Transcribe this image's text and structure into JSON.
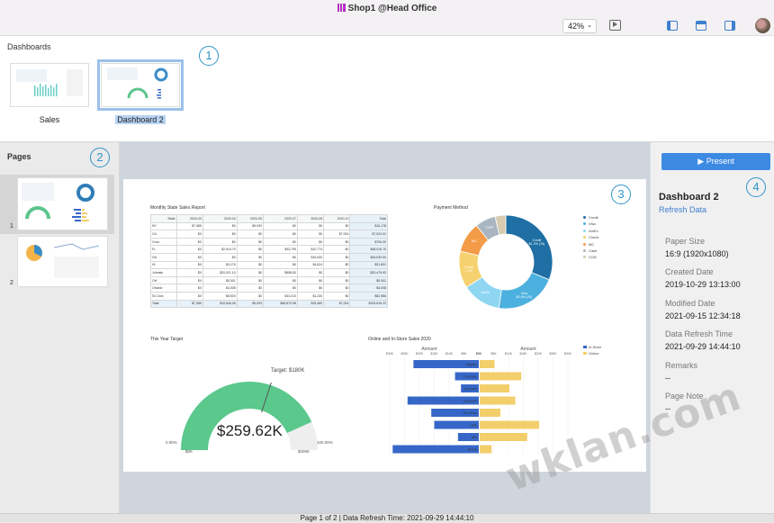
{
  "window": {
    "title": "Shop1 @Head Office",
    "zoom": "42%"
  },
  "toolbar": {
    "icons": [
      "presentation-icon",
      "layout-left-panel-icon",
      "layout-top-panel-icon",
      "layout-right-panel-icon"
    ]
  },
  "dashboards": {
    "label": "Dashboards",
    "items": [
      {
        "label": "Sales",
        "selected": false
      },
      {
        "label": "Dashboard 2",
        "selected": true
      }
    ]
  },
  "markers": [
    "1",
    "2",
    "3",
    "4"
  ],
  "pages": {
    "label": "Pages",
    "items": [
      {
        "number": "1",
        "selected": true
      },
      {
        "number": "2",
        "selected": false
      }
    ]
  },
  "report": {
    "table_title": "Monthly State Sales Report",
    "table_headers": [
      "State",
      "2020-03",
      "2020-04",
      "2020-05",
      "2020-07",
      "2020-08",
      "2020-10",
      "Total"
    ],
    "table_rows": [
      [
        "NY",
        "$7,085",
        "$0",
        "$9,093",
        "$0",
        "$0",
        "$0",
        "$16,178"
      ],
      [
        "CA",
        "$0",
        "$0",
        "$0",
        "$0",
        "$0",
        "$7,024",
        "$7,024.01"
      ],
      [
        "Conn",
        "$0",
        "$0",
        "$0",
        "$0",
        "$0",
        "$0",
        "$706.00"
      ],
      [
        "FL",
        "$0",
        "$2,914.70",
        "$0",
        "$33,795",
        "$10,774",
        "$0",
        "$48,016.70"
      ],
      [
        "GA",
        "$0",
        "$0",
        "$0",
        "$0",
        "$16,630",
        "$0",
        "$34,630.00"
      ],
      [
        "HI",
        "$0",
        "$3,176",
        "$0",
        "$0",
        "$4,624",
        "$0",
        "$31,801"
      ],
      [
        "Johnstn",
        "$0",
        "$20,021.10",
        "$0",
        "$558.83",
        "$0",
        "$0",
        "$20,479.93"
      ],
      [
        "OH",
        "$0",
        "$5,301",
        "$0",
        "$0",
        "$0",
        "$0",
        "$5,301"
      ],
      [
        "Ontario",
        "$0",
        "$4,008",
        "$0",
        "$0",
        "$0",
        "$0",
        "$4,008"
      ],
      [
        "St.Croix",
        "$0",
        "$8,500",
        "$0",
        "$33,210",
        "$1,230",
        "$0",
        "$52,986"
      ],
      [
        "Total",
        "$7,085",
        "$10,846.45",
        "$9,093",
        "$66,870.98",
        "$33,460",
        "$7,024",
        "$209,816.23"
      ]
    ],
    "payment_title": "Payment Method",
    "gauge_title": "This Year Target",
    "gauge_value": "$259.62K",
    "gauge_target": "Target: $180K",
    "gauge_min_pct": "0.00%",
    "gauge_max_pct": "100.00%",
    "gauge_min": "$0K",
    "gauge_max": "$300K",
    "bar_title": "Online and In-Store Sales 2020"
  },
  "chart_data": [
    {
      "type": "pie",
      "title": "Payment Method",
      "categories": [
        "Credit",
        "Visa",
        "AmEx",
        "Check",
        "MC",
        "Cash",
        "COD"
      ],
      "values": [
        31.2,
        21.2,
        13.5,
        12.8,
        10.5,
        7.1,
        3.7
      ],
      "slice_labels": [
        "Credit\n$1.2% (76)",
        "Visa\n$2.4% (33)",
        "AmEx",
        "Check\n2.4%",
        "MC",
        "Cash",
        ""
      ],
      "colors": [
        "#1f6fa4",
        "#4cb1de",
        "#8ed6f2",
        "#f6d16f",
        "#f39b47",
        "#a9b5c0",
        "#d8cbb0"
      ],
      "legend": "right"
    },
    {
      "type": "bar",
      "title": "Online and In-Store Sales 2020",
      "xlabel": "Amount",
      "categories": [
        "Alligator",
        "Chocolate",
        "Con grey",
        "Espresso",
        "Hot White",
        "Latte",
        "Milk",
        "Mocha"
      ],
      "series": [
        {
          "name": "In-Store",
          "values": [
            22,
            8,
            6,
            24,
            16,
            15,
            7,
            29
          ],
          "color": "#3667c8"
        },
        {
          "name": "Online",
          "values": [
            5,
            14,
            10,
            12,
            7,
            20,
            16,
            4
          ],
          "color": "#f2cf6b"
        }
      ],
      "left_ticks": [
        "$30K",
        "$25K",
        "$20K",
        "$15K",
        "$10K",
        "$5K",
        "$0K"
      ],
      "right_ticks": [
        "$0K",
        "$5K",
        "$10K",
        "$15K",
        "$20K",
        "$25K",
        "$30K"
      ],
      "legend": "right"
    },
    {
      "type": "gauge",
      "title": "This Year Target",
      "value": 259.62,
      "target": 180,
      "min": 0,
      "max": 300
    }
  ],
  "properties": {
    "present_label": "Present",
    "dashboard_title": "Dashboard 2",
    "refresh_label": "Refresh Data",
    "items": [
      {
        "label": "Paper Size",
        "value": "16:9 (1920x1080)"
      },
      {
        "label": "Created Date",
        "value": "2019-10-29 13:13:00"
      },
      {
        "label": "Modified Date",
        "value": "2021-09-15 12:34:18"
      },
      {
        "label": "Data Refresh Time",
        "value": "2021-09-29 14:44:10"
      },
      {
        "label": "Remarks",
        "value": "--"
      },
      {
        "label": "Page Note",
        "value": "--"
      }
    ]
  },
  "status": {
    "text": "Page 1 of 2 | Data Refresh Time: 2021-09-29 14:44:10"
  },
  "watermark": "wklan.com"
}
